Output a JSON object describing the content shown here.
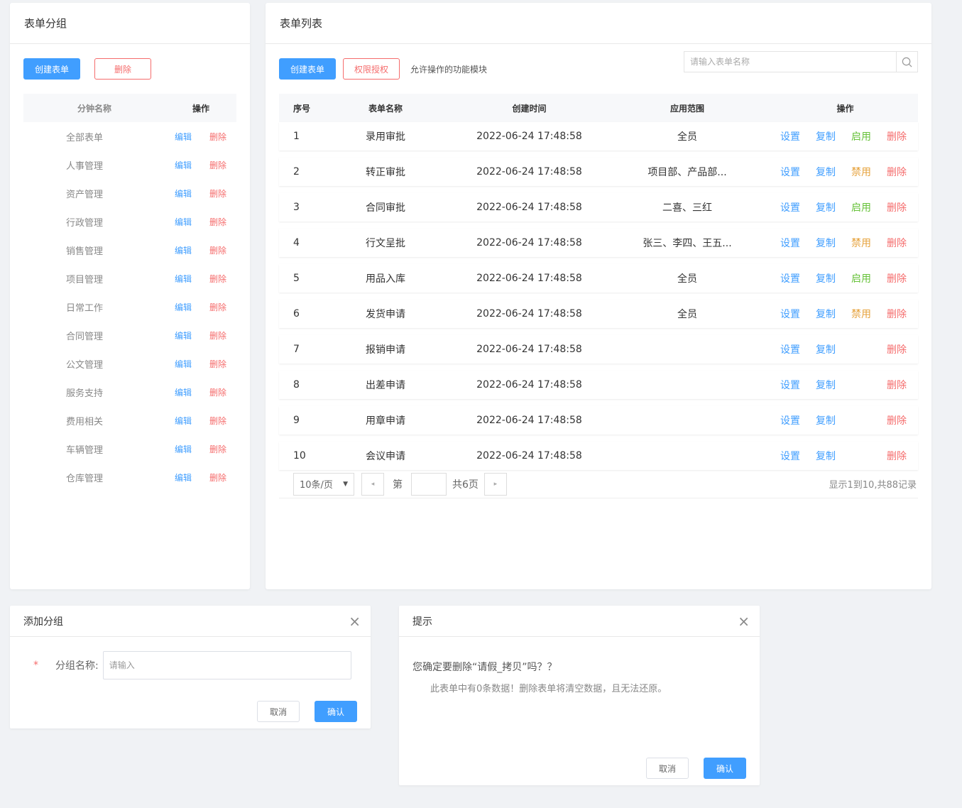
{
  "left": {
    "title": "表单分组",
    "create_label": "创建表单",
    "delete_label": "删除",
    "col_name": "分钟名称",
    "col_ops": "操作",
    "edit_label": "编辑",
    "row_delete_label": "删除",
    "groups": [
      "全部表单",
      "人事管理",
      "资产管理",
      "行政管理",
      "销售管理",
      "项目管理",
      "日常工作",
      "合同管理",
      "公文管理",
      "服务支持",
      "费用相关",
      "车辆管理",
      "仓库管理"
    ]
  },
  "right": {
    "title": "表单列表",
    "create_label": "创建表单",
    "auth_label": "权限授权",
    "hint": "允许操作的功能模块",
    "search_placeholder": "请输入表单名称",
    "columns": {
      "no": "序号",
      "name": "表单名称",
      "time": "创建时间",
      "scope": "应用范围",
      "ops": "操作"
    },
    "op_set": "设置",
    "op_copy": "复制",
    "op_delete": "删除",
    "rows": [
      {
        "no": "1",
        "name": "录用审批",
        "time": "2022-06-24 17:48:58",
        "scope": "全员",
        "toggle": "启用",
        "toggle_color": "#67c23a"
      },
      {
        "no": "2",
        "name": "转正审批",
        "time": "2022-06-24 17:48:58",
        "scope": "项目部、产品部...",
        "toggle": "禁用",
        "toggle_color": "#e6a23c"
      },
      {
        "no": "3",
        "name": "合同审批",
        "time": "2022-06-24 17:48:58",
        "scope": "二喜、三红",
        "toggle": "启用",
        "toggle_color": "#67c23a"
      },
      {
        "no": "4",
        "name": "行文呈批",
        "time": "2022-06-24 17:48:58",
        "scope": "张三、李四、王五...",
        "toggle": "禁用",
        "toggle_color": "#e6a23c"
      },
      {
        "no": "5",
        "name": "用品入库",
        "time": "2022-06-24 17:48:58",
        "scope": "全员",
        "toggle": "启用",
        "toggle_color": "#67c23a"
      },
      {
        "no": "6",
        "name": "发货申请",
        "time": "2022-06-24 17:48:58",
        "scope": "全员",
        "toggle": "禁用",
        "toggle_color": "#e6a23c"
      },
      {
        "no": "7",
        "name": "报销申请",
        "time": "2022-06-24 17:48:58",
        "scope": "",
        "toggle": "",
        "toggle_color": ""
      },
      {
        "no": "8",
        "name": "出差申请",
        "time": "2022-06-24 17:48:58",
        "scope": "",
        "toggle": "",
        "toggle_color": ""
      },
      {
        "no": "9",
        "name": "用章申请",
        "time": "2022-06-24 17:48:58",
        "scope": "",
        "toggle": "",
        "toggle_color": ""
      },
      {
        "no": "10",
        "name": "会议申请",
        "time": "2022-06-24 17:48:58",
        "scope": "",
        "toggle": "",
        "toggle_color": ""
      }
    ],
    "pager": {
      "page_size": "10条/页",
      "prefix": "第",
      "total_pages": "共6页",
      "info": "显示1到10,共88记录"
    }
  },
  "dialog_add": {
    "title": "添加分组",
    "required_mark": "*",
    "label": "分组名称:",
    "placeholder": "请输入",
    "cancel": "取消",
    "confirm": "确认"
  },
  "dialog_tip": {
    "title": "提示",
    "message": "您确定要删除“请假_拷贝”吗？？",
    "detail": "此表单中有0条数据！删除表单将清空数据，且无法还原。",
    "cancel": "取消",
    "confirm": "确认"
  },
  "colors": {
    "primary": "#409eff",
    "danger": "#f56c6c",
    "enable": "#67c23a",
    "disable": "#e6a23c"
  }
}
